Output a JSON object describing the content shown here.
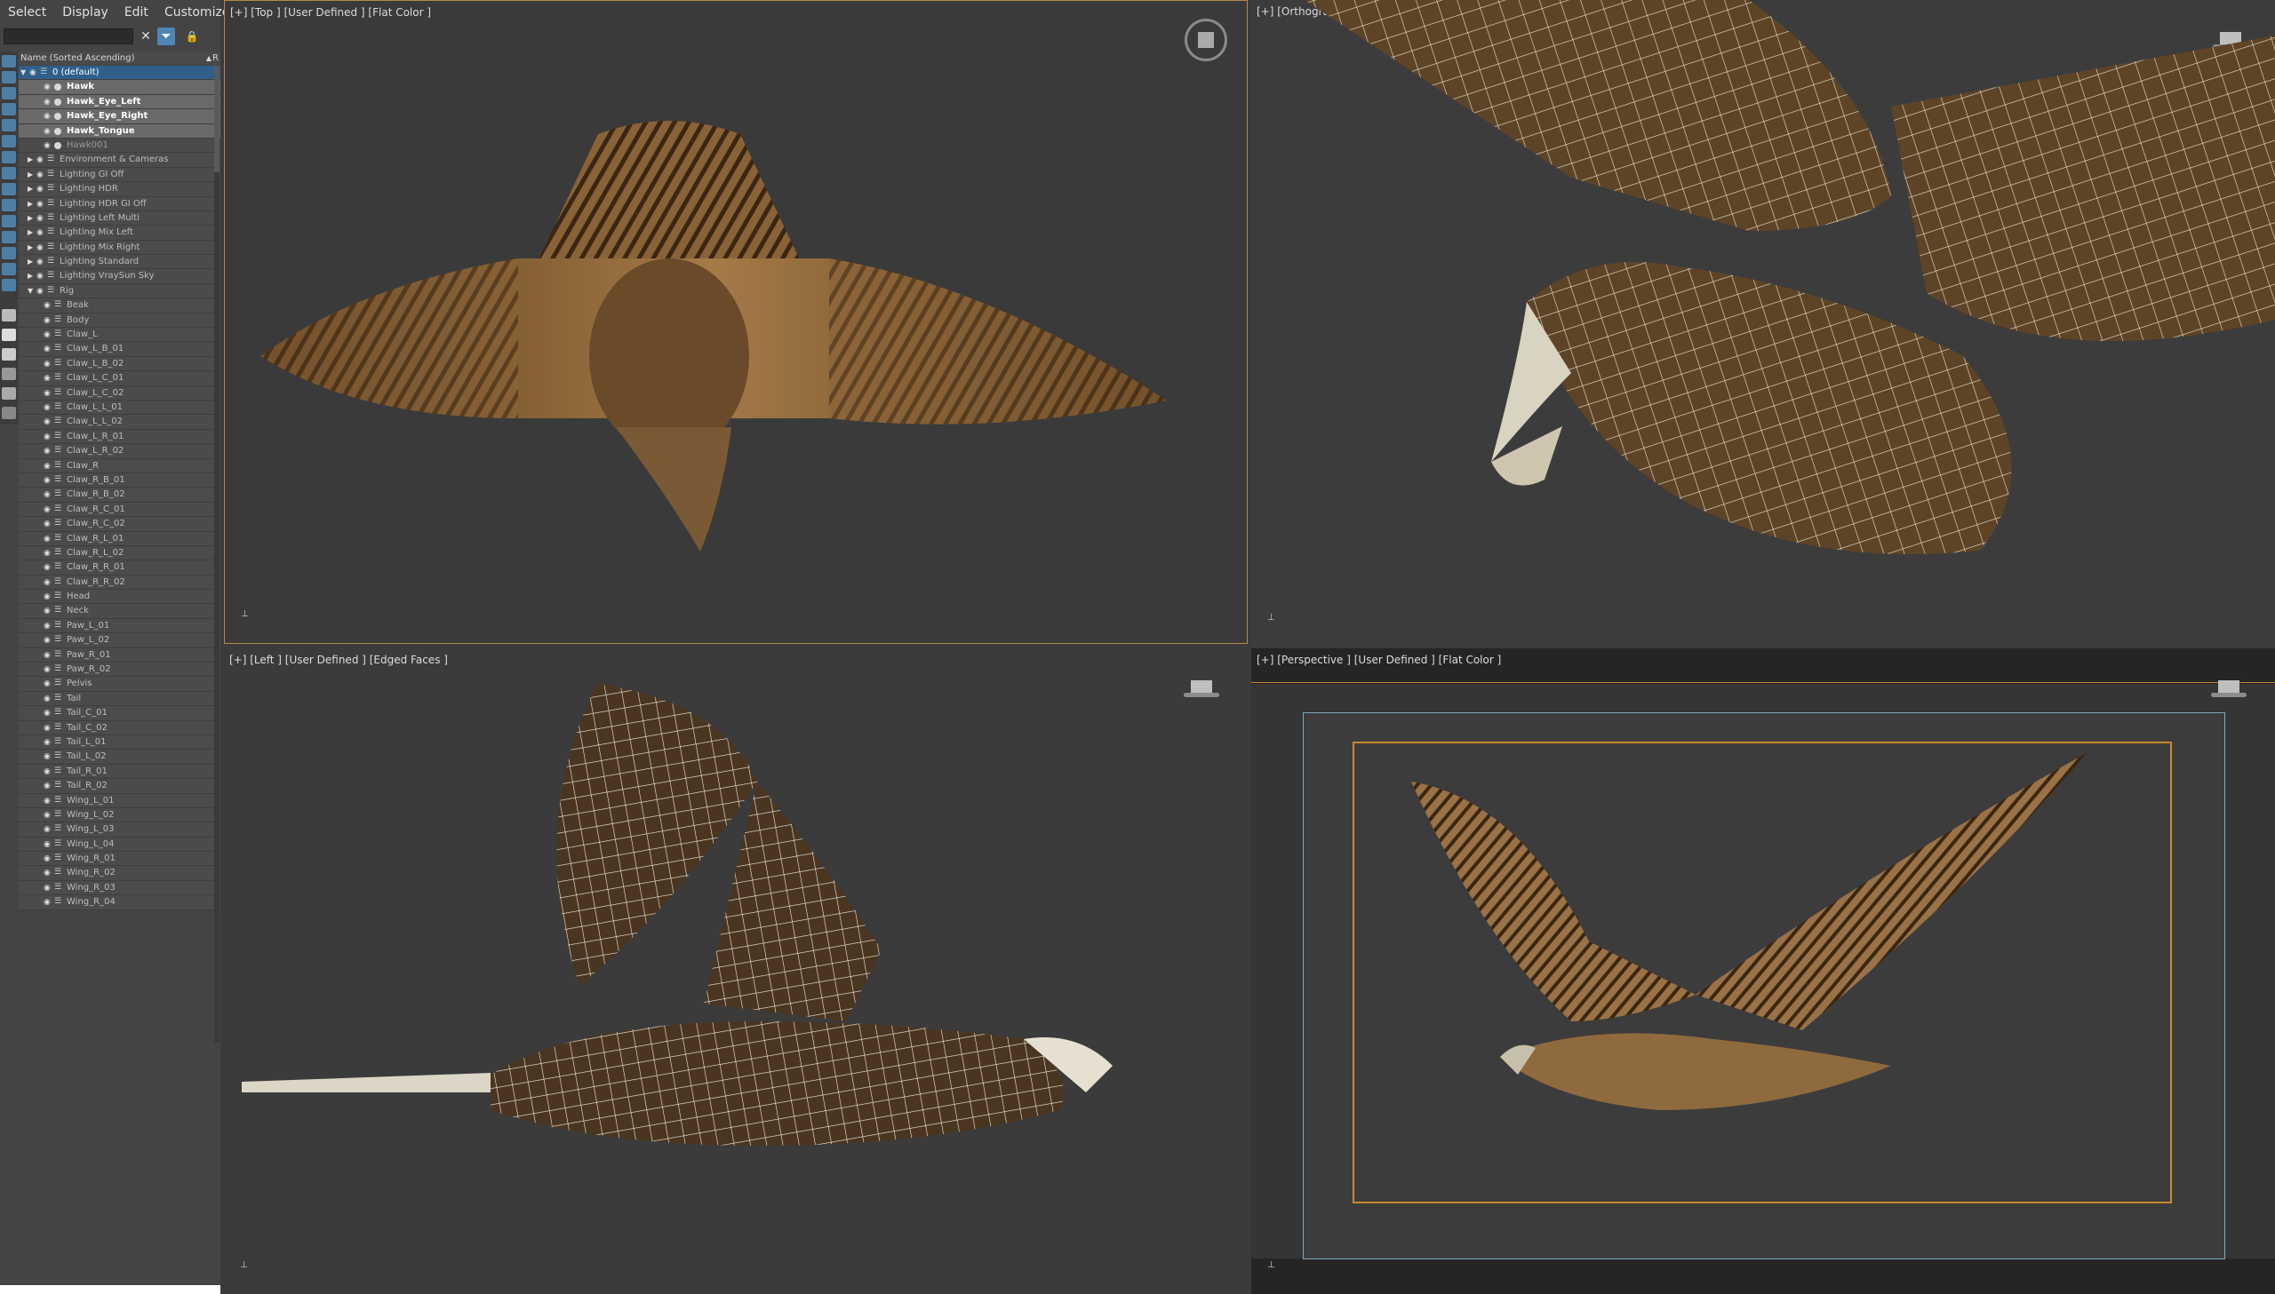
{
  "menubar": {
    "items": [
      "Select",
      "Display",
      "Edit",
      "Customize"
    ]
  },
  "explorer": {
    "search_placeholder": "",
    "column_header": "Name (Sorted Ascending)",
    "column_r": "R",
    "rows": [
      {
        "label": "0 (default)",
        "indent": 1,
        "state": "active"
      },
      {
        "label": "Hawk",
        "indent": 3,
        "state": "selected"
      },
      {
        "label": "Hawk_Eye_Left",
        "indent": 3,
        "state": "selected"
      },
      {
        "label": "Hawk_Eye_Right",
        "indent": 3,
        "state": "selected"
      },
      {
        "label": "Hawk_Tongue",
        "indent": 3,
        "state": "selected"
      },
      {
        "label": "Hawk001",
        "indent": 3,
        "state": "dim"
      },
      {
        "label": "Environment & Cameras",
        "indent": 2,
        "state": ""
      },
      {
        "label": "Lighting GI Off",
        "indent": 2,
        "state": ""
      },
      {
        "label": "Lighting HDR",
        "indent": 2,
        "state": ""
      },
      {
        "label": "Lighting HDR GI Off",
        "indent": 2,
        "state": ""
      },
      {
        "label": "Lighting Left Multi",
        "indent": 2,
        "state": ""
      },
      {
        "label": "Lighting Mix Left",
        "indent": 2,
        "state": ""
      },
      {
        "label": "Lighting Mix Right",
        "indent": 2,
        "state": ""
      },
      {
        "label": "Lighting Standard",
        "indent": 2,
        "state": ""
      },
      {
        "label": "Lighting VraySun Sky",
        "indent": 2,
        "state": ""
      },
      {
        "label": "Rig",
        "indent": 2,
        "state": ""
      },
      {
        "label": "Beak",
        "indent": 3,
        "state": ""
      },
      {
        "label": "Body",
        "indent": 3,
        "state": ""
      },
      {
        "label": "Claw_L",
        "indent": 3,
        "state": ""
      },
      {
        "label": "Claw_L_B_01",
        "indent": 3,
        "state": ""
      },
      {
        "label": "Claw_L_B_02",
        "indent": 3,
        "state": ""
      },
      {
        "label": "Claw_L_C_01",
        "indent": 3,
        "state": ""
      },
      {
        "label": "Claw_L_C_02",
        "indent": 3,
        "state": ""
      },
      {
        "label": "Claw_L_L_01",
        "indent": 3,
        "state": ""
      },
      {
        "label": "Claw_L_L_02",
        "indent": 3,
        "state": ""
      },
      {
        "label": "Claw_L_R_01",
        "indent": 3,
        "state": ""
      },
      {
        "label": "Claw_L_R_02",
        "indent": 3,
        "state": ""
      },
      {
        "label": "Claw_R",
        "indent": 3,
        "state": ""
      },
      {
        "label": "Claw_R_B_01",
        "indent": 3,
        "state": ""
      },
      {
        "label": "Claw_R_B_02",
        "indent": 3,
        "state": ""
      },
      {
        "label": "Claw_R_C_01",
        "indent": 3,
        "state": ""
      },
      {
        "label": "Claw_R_C_02",
        "indent": 3,
        "state": ""
      },
      {
        "label": "Claw_R_L_01",
        "indent": 3,
        "state": ""
      },
      {
        "label": "Claw_R_L_02",
        "indent": 3,
        "state": ""
      },
      {
        "label": "Claw_R_R_01",
        "indent": 3,
        "state": ""
      },
      {
        "label": "Claw_R_R_02",
        "indent": 3,
        "state": ""
      },
      {
        "label": "Head",
        "indent": 3,
        "state": ""
      },
      {
        "label": "Neck",
        "indent": 3,
        "state": ""
      },
      {
        "label": "Paw_L_01",
        "indent": 3,
        "state": ""
      },
      {
        "label": "Paw_L_02",
        "indent": 3,
        "state": ""
      },
      {
        "label": "Paw_R_01",
        "indent": 3,
        "state": ""
      },
      {
        "label": "Paw_R_02",
        "indent": 3,
        "state": ""
      },
      {
        "label": "Pelvis",
        "indent": 3,
        "state": ""
      },
      {
        "label": "Tail",
        "indent": 3,
        "state": ""
      },
      {
        "label": "Tail_C_01",
        "indent": 3,
        "state": ""
      },
      {
        "label": "Tail_C_02",
        "indent": 3,
        "state": ""
      },
      {
        "label": "Tail_L_01",
        "indent": 3,
        "state": ""
      },
      {
        "label": "Tail_L_02",
        "indent": 3,
        "state": ""
      },
      {
        "label": "Tail_R_01",
        "indent": 3,
        "state": ""
      },
      {
        "label": "Tail_R_02",
        "indent": 3,
        "state": ""
      },
      {
        "label": "Wing_L_01",
        "indent": 3,
        "state": ""
      },
      {
        "label": "Wing_L_02",
        "indent": 3,
        "state": ""
      },
      {
        "label": "Wing_L_03",
        "indent": 3,
        "state": ""
      },
      {
        "label": "Wing_L_04",
        "indent": 3,
        "state": ""
      },
      {
        "label": "Wing_R_01",
        "indent": 3,
        "state": ""
      },
      {
        "label": "Wing_R_02",
        "indent": 3,
        "state": ""
      },
      {
        "label": "Wing_R_03",
        "indent": 3,
        "state": ""
      },
      {
        "label": "Wing_R_04",
        "indent": 3,
        "state": ""
      }
    ]
  },
  "viewports": {
    "top": {
      "label": "[+] [Top ] [User Defined ] [Flat Color ]"
    },
    "ortho": {
      "label": "[+] [Orthographic ] [User Defined ] [Flat Color + Edged Faces ]"
    },
    "left": {
      "label": "[+] [Left ] [User Defined ] [Edged Faces ]"
    },
    "perspective": {
      "label": "[+] [Perspective ] [User Defined ] [Flat Color ]"
    }
  },
  "colors": {
    "active_border": "#b5894a",
    "safe_frame": "#c8882e",
    "frame_outer": "#7fa7c0",
    "selection": "#2f5f8a"
  }
}
